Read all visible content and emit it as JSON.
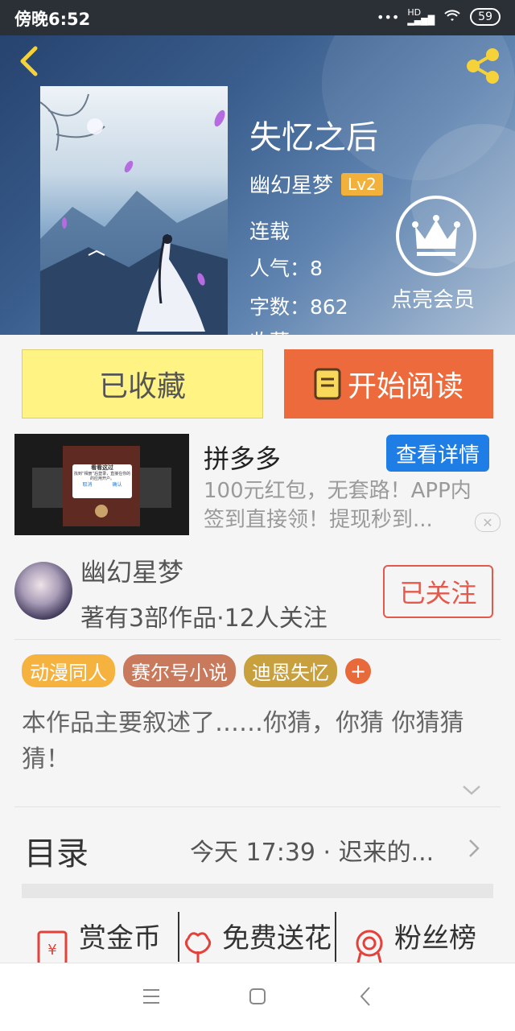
{
  "status_bar": {
    "time": "傍晚6:52",
    "network": "HD",
    "battery": "59"
  },
  "book": {
    "title": "失忆之后",
    "author": "幽幻星梦",
    "level": "Lv2",
    "state": "连载",
    "popularity": "人气：8",
    "word_count": "字数：862",
    "cut_line": "收藏"
  },
  "vip": {
    "label": "点亮会员"
  },
  "buttons": {
    "collect": "已收藏",
    "read": "开始阅读"
  },
  "ad": {
    "title": "拼多多",
    "detail_button": "查看详情",
    "description": "100元红包，无套路！APP内签到直接领！提现秒到...",
    "dialog_title": "看看这过",
    "dialog_text": "找到“相册”后登录，直接在你的的应用开户。",
    "dialog_cancel": "取消",
    "dialog_ok": "确认"
  },
  "author_section": {
    "name": "幽幻星梦",
    "stats": "著有3部作品·12人关注",
    "follow_button": "已关注"
  },
  "tags": [
    {
      "label": "动漫同人",
      "color": "#f6b23e"
    },
    {
      "label": "赛尔号小说",
      "color": "#c97a5c"
    },
    {
      "label": "迪恩失忆",
      "color": "#c8a03e"
    }
  ],
  "tag_add": "+",
  "summary": "本作品主要叙述了……你猜，你猜 你猜猜猜！",
  "toc": {
    "label": "目录",
    "latest": "今天 17:39 · 迟来的..."
  },
  "actions": [
    {
      "label": "赏金币",
      "icon": "red-envelope-icon"
    },
    {
      "label": "免费送花",
      "icon": "flower-icon"
    },
    {
      "label": "粉丝榜",
      "icon": "medal-icon"
    }
  ],
  "colors": {
    "accent_orange": "#ec6a3c",
    "collect_yellow": "#fff483",
    "follow_red": "#e35a4c",
    "ad_blue": "#1e7ee6"
  }
}
